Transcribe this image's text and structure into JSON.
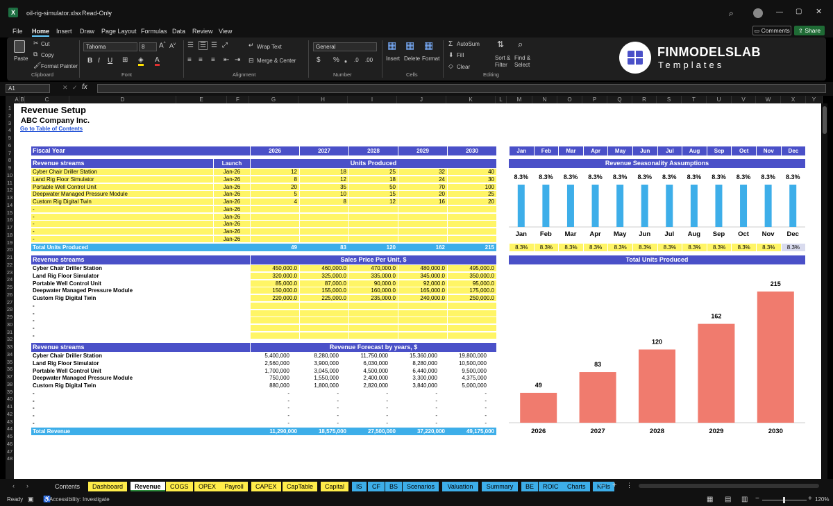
{
  "titlebar": {
    "filename": "oil-rig-simulator.xlsx",
    "mode": "Read-Only"
  },
  "menu": [
    "File",
    "Home",
    "Insert",
    "Draw",
    "Page Layout",
    "Formulas",
    "Data",
    "Review",
    "View"
  ],
  "comments_label": "Comments",
  "share_label": "Share",
  "ribbon": {
    "paste": "Paste",
    "cut": "Cut",
    "copy": "Copy",
    "format_painter": "Format Painter",
    "clipboard": "Clipboard",
    "font_name": "Tahoma",
    "font_size": "8",
    "font": "Font",
    "wrap_text": "Wrap Text",
    "merge_center": "Merge & Center",
    "alignment": "Alignment",
    "number_format": "General",
    "number": "Number",
    "insert": "Insert",
    "delete": "Delete",
    "format": "Format",
    "cells": "Cells",
    "autosum": "AutoSum",
    "fill": "Fill",
    "clear": "Clear",
    "sort_filter": "Sort &",
    "sort_filter2": "Filter",
    "find_select": "Find &",
    "find_select2": "Select",
    "editing": "Editing",
    "brand1": "FINMODELSLAB",
    "brand2": "Templates"
  },
  "namebox": "A1",
  "columns": [
    "A",
    "B",
    "C",
    "D",
    "E",
    "F",
    "G",
    "H",
    "I",
    "J",
    "K",
    "L",
    "M",
    "N",
    "O",
    "P",
    "Q",
    "R",
    "S",
    "T",
    "U",
    "V",
    "W",
    "X",
    "Y"
  ],
  "sheet": {
    "title": "Revenue Setup",
    "company": "ABC Company Inc.",
    "toc_link": "Go to Table of Contents",
    "fiscal_year": "Fiscal Year",
    "years": [
      "2026",
      "2027",
      "2028",
      "2029",
      "2030"
    ],
    "months": [
      "Jan",
      "Feb",
      "Mar",
      "Apr",
      "May",
      "Jun",
      "Jul",
      "Aug",
      "Sep",
      "Oct",
      "Nov",
      "Dec"
    ],
    "streams_label": "Revenue streams",
    "launch_label": "Launch",
    "units_header": "Units Produced",
    "units": [
      {
        "name": "Cyber Chair Driller Station",
        "launch": "Jan-26",
        "v": [
          "12",
          "18",
          "25",
          "32",
          "40"
        ]
      },
      {
        "name": "Land Rig Floor Simulator",
        "launch": "Jan-26",
        "v": [
          "8",
          "12",
          "18",
          "24",
          "30"
        ]
      },
      {
        "name": "Portable Well Control Unit",
        "launch": "Jan-26",
        "v": [
          "20",
          "35",
          "50",
          "70",
          "100"
        ]
      },
      {
        "name": "Deepwater Managed Pressure Module",
        "launch": "Jan-26",
        "v": [
          "5",
          "10",
          "15",
          "20",
          "25"
        ]
      },
      {
        "name": "Custom Rig Digital Twin",
        "launch": "Jan-26",
        "v": [
          "4",
          "8",
          "12",
          "16",
          "20"
        ]
      },
      {
        "name": "-",
        "launch": "Jan-26",
        "v": [
          "",
          "",
          "",
          "",
          ""
        ]
      },
      {
        "name": "-",
        "launch": "Jan-26",
        "v": [
          "",
          "",
          "",
          "",
          ""
        ]
      },
      {
        "name": "-",
        "launch": "Jan-26",
        "v": [
          "",
          "",
          "",
          "",
          ""
        ]
      },
      {
        "name": "-",
        "launch": "Jan-26",
        "v": [
          "",
          "",
          "",
          "",
          ""
        ]
      },
      {
        "name": "-",
        "launch": "Jan-26",
        "v": [
          "",
          "",
          "",
          "",
          ""
        ]
      }
    ],
    "total_units_label": "Total Units Produced",
    "total_units": [
      "49",
      "83",
      "120",
      "162",
      "215"
    ],
    "price_header": "Sales Price Per Unit, $",
    "prices": [
      {
        "name": "Cyber Chair Driller Station",
        "v": [
          "450,000.0",
          "460,000.0",
          "470,000.0",
          "480,000.0",
          "495,000.0"
        ]
      },
      {
        "name": "Land Rig Floor Simulator",
        "v": [
          "320,000.0",
          "325,000.0",
          "335,000.0",
          "345,000.0",
          "350,000.0"
        ]
      },
      {
        "name": "Portable Well Control Unit",
        "v": [
          "85,000.0",
          "87,000.0",
          "90,000.0",
          "92,000.0",
          "95,000.0"
        ]
      },
      {
        "name": "Deepwater Managed Pressure Module",
        "v": [
          "150,000.0",
          "155,000.0",
          "160,000.0",
          "165,000.0",
          "175,000.0"
        ]
      },
      {
        "name": "Custom Rig Digital Twin",
        "v": [
          "220,000.0",
          "225,000.0",
          "235,000.0",
          "240,000.0",
          "250,000.0"
        ]
      },
      {
        "name": "-",
        "v": [
          "",
          "",
          "",
          "",
          ""
        ]
      },
      {
        "name": "-",
        "v": [
          "",
          "",
          "",
          "",
          ""
        ]
      },
      {
        "name": "-",
        "v": [
          "",
          "",
          "",
          "",
          ""
        ]
      },
      {
        "name": "-",
        "v": [
          "",
          "",
          "",
          "",
          ""
        ]
      },
      {
        "name": "-",
        "v": [
          "",
          "",
          "",
          "",
          ""
        ]
      }
    ],
    "forecast_header": "Revenue Forecast by years, $",
    "forecast": [
      {
        "name": "Cyber Chair Driller Station",
        "v": [
          "5,400,000",
          "8,280,000",
          "11,750,000",
          "15,360,000",
          "19,800,000"
        ]
      },
      {
        "name": "Land Rig Floor Simulator",
        "v": [
          "2,560,000",
          "3,900,000",
          "6,030,000",
          "8,280,000",
          "10,500,000"
        ]
      },
      {
        "name": "Portable Well Control Unit",
        "v": [
          "1,700,000",
          "3,045,000",
          "4,500,000",
          "6,440,000",
          "9,500,000"
        ]
      },
      {
        "name": "Deepwater Managed Pressure Module",
        "v": [
          "750,000",
          "1,550,000",
          "2,400,000",
          "3,300,000",
          "4,375,000"
        ]
      },
      {
        "name": "Custom Rig Digital Twin",
        "v": [
          "880,000",
          "1,800,000",
          "2,820,000",
          "3,840,000",
          "5,000,000"
        ]
      },
      {
        "name": "-",
        "v": [
          "-",
          "-",
          "-",
          "-",
          "-"
        ]
      },
      {
        "name": "-",
        "v": [
          "-",
          "-",
          "-",
          "-",
          "-"
        ]
      },
      {
        "name": "-",
        "v": [
          "-",
          "-",
          "-",
          "-",
          "-"
        ]
      },
      {
        "name": "-",
        "v": [
          "-",
          "-",
          "-",
          "-",
          "-"
        ]
      },
      {
        "name": "-",
        "v": [
          "-",
          "-",
          "-",
          "-",
          "-"
        ]
      }
    ],
    "total_revenue_label": "Total Revenue",
    "total_revenue": [
      "11,290,000",
      "18,575,000",
      "27,500,000",
      "37,220,000",
      "49,175,000"
    ],
    "seasonality_header": "Revenue Seasonality Assumptions",
    "seasonality": [
      "8.3%",
      "8.3%",
      "8.3%",
      "8.3%",
      "8.3%",
      "8.3%",
      "8.3%",
      "8.3%",
      "8.3%",
      "8.3%",
      "8.3%",
      "8.3%"
    ],
    "units_chart_header": "Total Units Produced"
  },
  "chart_data": [
    {
      "type": "bar",
      "categories": [
        "Jan",
        "Feb",
        "Mar",
        "Apr",
        "May",
        "Jun",
        "Jul",
        "Aug",
        "Sep",
        "Oct",
        "Nov",
        "Dec"
      ],
      "values": [
        8.3,
        8.3,
        8.3,
        8.3,
        8.3,
        8.3,
        8.3,
        8.3,
        8.3,
        8.3,
        8.3,
        8.3
      ],
      "labels": [
        "8.3%",
        "8.3%",
        "8.3%",
        "8.3%",
        "8.3%",
        "8.3%",
        "8.3%",
        "8.3%",
        "8.3%",
        "8.3%",
        "8.3%",
        "8.3%"
      ],
      "ylim": [
        0,
        8.3
      ],
      "color": "#3daee9"
    },
    {
      "type": "bar",
      "categories": [
        "2026",
        "2027",
        "2028",
        "2029",
        "2030"
      ],
      "values": [
        49,
        83,
        120,
        162,
        215
      ],
      "ylim": [
        0,
        215
      ],
      "color": "#f07b6e"
    }
  ],
  "tabs": [
    {
      "label": "Contents",
      "style": "plain"
    },
    {
      "label": "Dashboard",
      "style": "y"
    },
    {
      "label": "Revenue",
      "style": "active"
    },
    {
      "label": "COGS",
      "style": "y"
    },
    {
      "label": "OPEX",
      "style": "y"
    },
    {
      "label": "Payroll",
      "style": "y"
    },
    {
      "label": "CAPEX",
      "style": "y"
    },
    {
      "label": "CapTable",
      "style": "y"
    },
    {
      "label": "Capital",
      "style": "y"
    },
    {
      "label": "IS",
      "style": "bl"
    },
    {
      "label": "CF",
      "style": "bl"
    },
    {
      "label": "BS",
      "style": "bl"
    },
    {
      "label": "Scenarios",
      "style": "bl"
    },
    {
      "label": "Valuation",
      "style": "bl"
    },
    {
      "label": "Summary",
      "style": "bl"
    },
    {
      "label": "BE",
      "style": "bl"
    },
    {
      "label": "ROIC",
      "style": "bl"
    },
    {
      "label": "Charts",
      "style": "bl"
    },
    {
      "label": "KPIs",
      "style": "bl"
    }
  ],
  "status": {
    "ready": "Ready",
    "accessibility": "Accessibility: Investigate",
    "zoom": "120%"
  }
}
